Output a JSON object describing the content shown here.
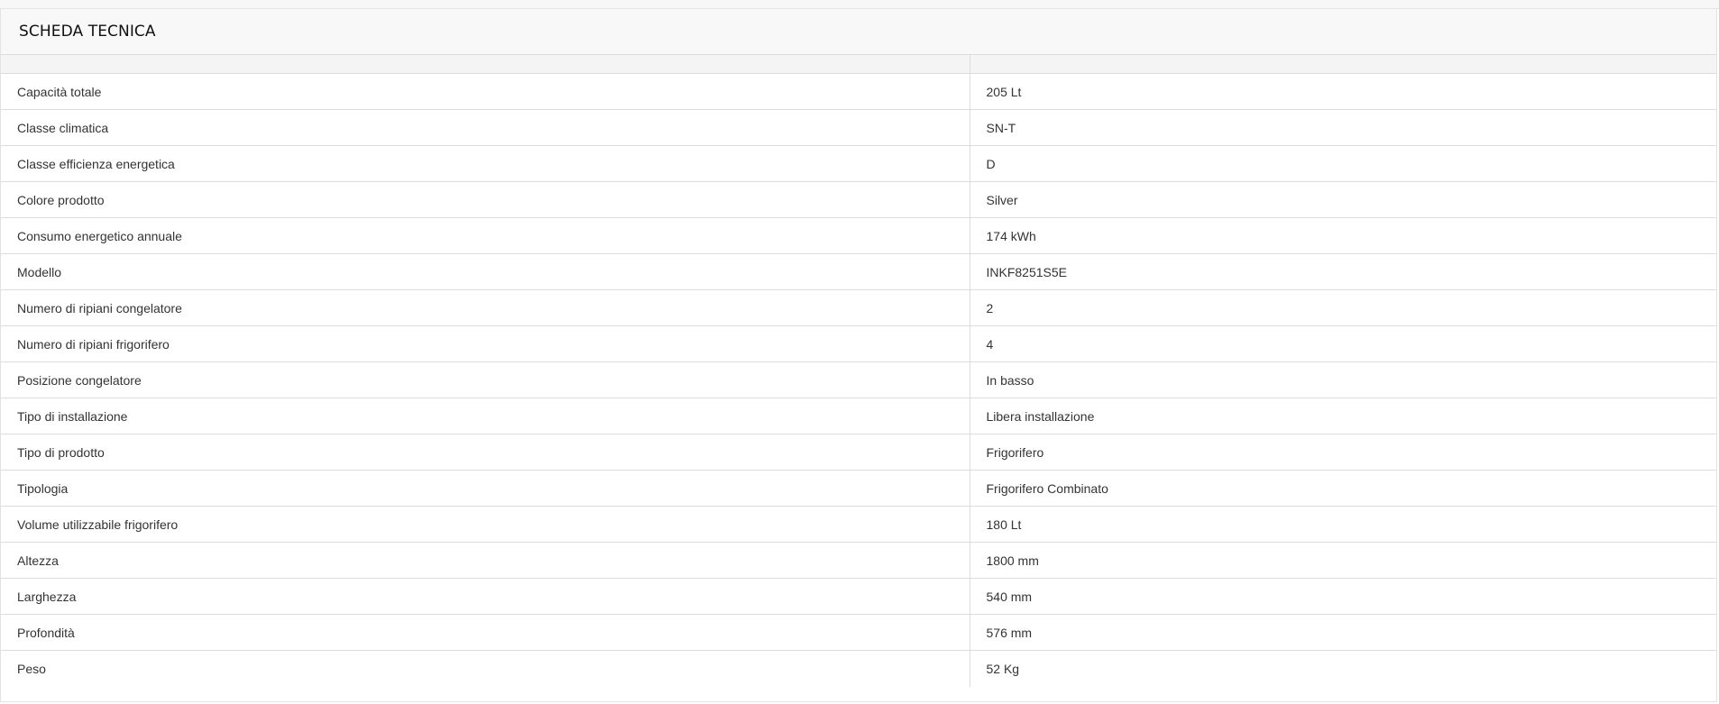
{
  "panel": {
    "title": "SCHEDA TECNICA"
  },
  "table": {
    "header": [
      "",
      ""
    ],
    "rows": [
      {
        "label": "Capacità totale",
        "value": "205 Lt"
      },
      {
        "label": "Classe climatica",
        "value": "SN-T"
      },
      {
        "label": "Classe efficienza energetica",
        "value": "D"
      },
      {
        "label": "Colore prodotto",
        "value": "Silver"
      },
      {
        "label": "Consumo energetico annuale",
        "value": "174 kWh"
      },
      {
        "label": "Modello",
        "value": "INKF8251S5E"
      },
      {
        "label": "Numero di ripiani congelatore",
        "value": "2"
      },
      {
        "label": "Numero di ripiani frigorifero",
        "value": "4"
      },
      {
        "label": "Posizione congelatore",
        "value": "In basso"
      },
      {
        "label": "Tipo di installazione",
        "value": "Libera installazione"
      },
      {
        "label": "Tipo di prodotto",
        "value": "Frigorifero"
      },
      {
        "label": "Tipologia",
        "value": "Frigorifero Combinato"
      },
      {
        "label": "Volume utilizzabile frigorifero",
        "value": "180 Lt"
      },
      {
        "label": "Altezza",
        "value": "1800 mm"
      },
      {
        "label": "Larghezza",
        "value": "540 mm"
      },
      {
        "label": "Profondità",
        "value": "576 mm"
      },
      {
        "label": "Peso",
        "value": "52 Kg"
      }
    ]
  }
}
